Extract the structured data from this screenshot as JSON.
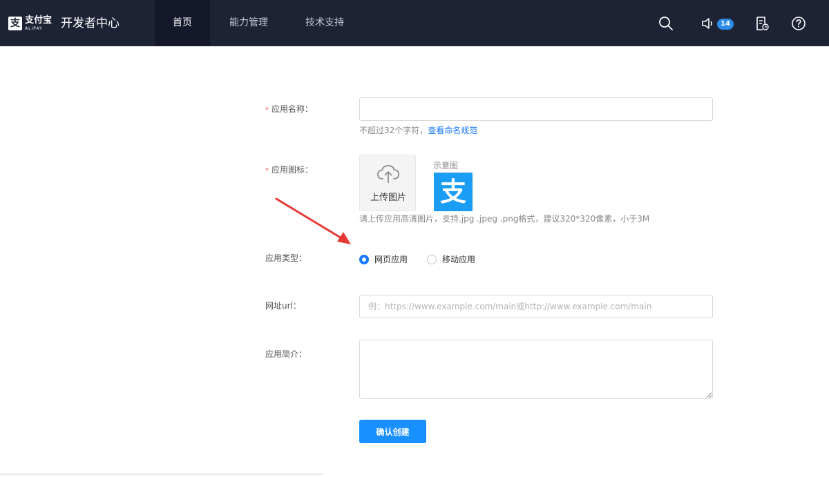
{
  "header": {
    "logo_text": "支付宝",
    "logo_sub": "ALIPAY",
    "brand_title": "开发者中心",
    "nav": [
      {
        "label": "首页",
        "active": true
      },
      {
        "label": "能力管理",
        "active": false
      },
      {
        "label": "技术支持",
        "active": false
      }
    ],
    "icons": [
      "search-icon",
      "speaker-icon",
      "document-icon",
      "help-icon"
    ],
    "notification_count": "14"
  },
  "form": {
    "name": {
      "label": "应用名称：",
      "required_mark": "*",
      "value": "",
      "hint": "不超过32个字符，",
      "hint_link": "查看命名规范"
    },
    "icon": {
      "label": "应用图标：",
      "required_mark": "*",
      "upload_label": "上传图片",
      "sample_label": "示意图",
      "sample_logo_glyph": "支",
      "hint": "请上传应用高清图片，支持.jpg .jpeg .png格式，建议320*320像素，小于3M"
    },
    "type": {
      "label": "应用类型：",
      "options": [
        {
          "label": "网页应用",
          "selected": true
        },
        {
          "label": "移动应用",
          "selected": false
        }
      ]
    },
    "url": {
      "label": "网址url：",
      "value": "",
      "placeholder": "例：https://www.example.com/main或http://www.example.com/main"
    },
    "description": {
      "label": "应用简介：",
      "value": ""
    },
    "submit_label": "确认创建"
  },
  "colors": {
    "header_bg": "#1e2235",
    "accent": "#1890ff",
    "required": "#e84c3d",
    "annotation_arrow": "#e53935"
  }
}
